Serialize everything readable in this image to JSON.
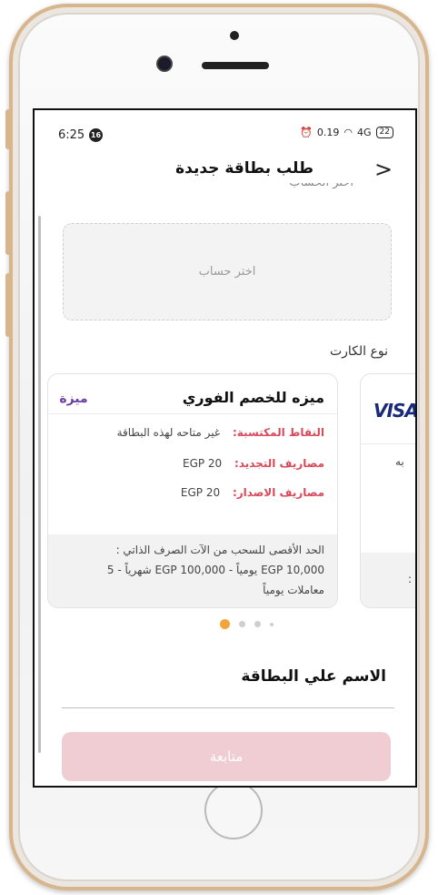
{
  "status_bar": {
    "time": "6:25",
    "notification_count": "16",
    "network_speed": "0.19",
    "signal": "4G",
    "battery": "22"
  },
  "header": {
    "title": "طلب بطاقة جديدة",
    "back_icon": "chevron-icon"
  },
  "account": {
    "section_label_cut": "اختر الحساب",
    "placeholder": "اختر حساب"
  },
  "card_type_label": "نوع الكارت",
  "cards": [
    {
      "title": "ميزه للخصم الفوري",
      "logo_text": "ميزة",
      "points_label": "النقاط المكتسبة:",
      "points_value": "غير متاحه لهذه البطاقة",
      "renewal_label": "مصاريف التجديد:",
      "renewal_value": "EGP 20",
      "issue_label": "مصاريف الاصدار:",
      "issue_value": "EGP 20",
      "footer_line1": "الحد الأقصى للسحب من الآت الصرف الذاتي :",
      "footer_line2": "EGP 10,000 يومياً - EGP 100,000 شهرياً - 5",
      "footer_line3": "معاملات يومياً"
    },
    {
      "logo_text": "VISA",
      "fragment": "به",
      "footer_fragment": ":"
    }
  ],
  "pager": {
    "active_index": 0,
    "count": 4
  },
  "name_on_card": {
    "label": "الاسم علي البطاقة",
    "value": ""
  },
  "continue_label": "متابعة",
  "colors": {
    "accent": "#d84a5a",
    "button_disabled": "#f0cdd3",
    "pager_active": "#f2a53a",
    "frame_gold": "#d7b58d"
  }
}
